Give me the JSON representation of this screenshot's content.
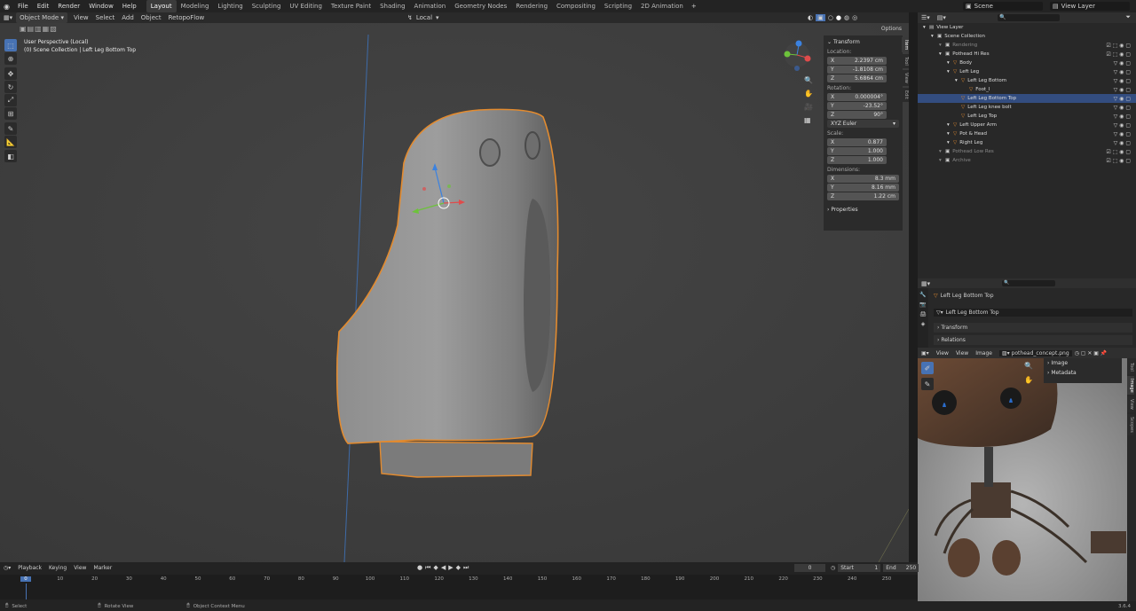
{
  "menu": [
    "File",
    "Edit",
    "Render",
    "Window",
    "Help"
  ],
  "workspaces": [
    {
      "label": "Layout",
      "active": true
    },
    {
      "label": "Modeling"
    },
    {
      "label": "Lighting"
    },
    {
      "label": "Sculpting"
    },
    {
      "label": "UV Editing"
    },
    {
      "label": "Texture Paint"
    },
    {
      "label": "Shading"
    },
    {
      "label": "Animation"
    },
    {
      "label": "Geometry Nodes"
    },
    {
      "label": "Rendering"
    },
    {
      "label": "Compositing"
    },
    {
      "label": "Scripting"
    },
    {
      "label": "2D Animation"
    }
  ],
  "scene": "Scene",
  "view_layer": "View Layer",
  "viewport": {
    "mode": "Object Mode",
    "menus": [
      "View",
      "Select",
      "Add",
      "Object",
      "RetopoFlow"
    ],
    "transform_orientation": "Local",
    "options": "Options",
    "overlay_line1": "User Perspective (Local)",
    "overlay_line2": "(0) Scene Collection | Left Leg Bottom Top"
  },
  "npanel": {
    "header": "Transform",
    "location_label": "Location:",
    "location": [
      {
        "axis": "X",
        "value": "2.2397 cm"
      },
      {
        "axis": "Y",
        "value": "-1.8108 cm"
      },
      {
        "axis": "Z",
        "value": "5.6864 cm"
      }
    ],
    "rotation_label": "Rotation:",
    "rotation": [
      {
        "axis": "X",
        "value": "0.000004°"
      },
      {
        "axis": "Y",
        "value": "-23.52°"
      },
      {
        "axis": "Z",
        "value": "90°"
      }
    ],
    "rotation_mode": "XYZ Euler",
    "scale_label": "Scale:",
    "scale": [
      {
        "axis": "X",
        "value": "0.877"
      },
      {
        "axis": "Y",
        "value": "1.000"
      },
      {
        "axis": "Z",
        "value": "1.000"
      }
    ],
    "dimensions_label": "Dimensions:",
    "dimensions": [
      {
        "axis": "X",
        "value": "8.3 mm"
      },
      {
        "axis": "Y",
        "value": "8.16 mm"
      },
      {
        "axis": "Z",
        "value": "1.22 cm"
      }
    ],
    "properties": "Properties",
    "tabs": [
      "Item",
      "Tool",
      "View",
      "Edit"
    ]
  },
  "outliner": {
    "rows": [
      "View Layer",
      "Scene Collection",
      "Rendering",
      "Pothead Hi Res",
      "Body",
      "Left Leg",
      "Left Leg Bottom",
      "Foot_I",
      "Left Leg Bottom Top",
      "Left Leg knee bolt",
      "Left Leg Top",
      "Left Upper Arm",
      "Pot & Head",
      "Right Leg",
      "Pothead Low Res",
      "Archive"
    ]
  },
  "properties": {
    "object_name": "Left Leg Bottom Top",
    "data_name": "Left Leg Bottom Top",
    "sections": [
      "Transform",
      "Relations"
    ]
  },
  "image_editor": {
    "menus": [
      "View",
      "View",
      "Image"
    ],
    "image_name": "pothead_concept.png",
    "sections": [
      "Image",
      "Metadata"
    ],
    "tabs": [
      "Tool",
      "Image",
      "View",
      "Scopes"
    ]
  },
  "timeline": {
    "menus": [
      "Playback",
      "Keying",
      "View",
      "Marker"
    ],
    "current_frame": "0",
    "start_label": "Start",
    "start": "1",
    "end_label": "End",
    "end": "250",
    "ticks": [
      "0",
      "10",
      "20",
      "30",
      "40",
      "50",
      "60",
      "70",
      "80",
      "90",
      "100",
      "110",
      "120",
      "130",
      "140",
      "150",
      "160",
      "170",
      "180",
      "190",
      "200",
      "210",
      "220",
      "230",
      "240",
      "250"
    ]
  },
  "status": {
    "select": "Select",
    "rotate": "Rotate View",
    "context": "Object Context Menu",
    "version": "3.6.4"
  }
}
